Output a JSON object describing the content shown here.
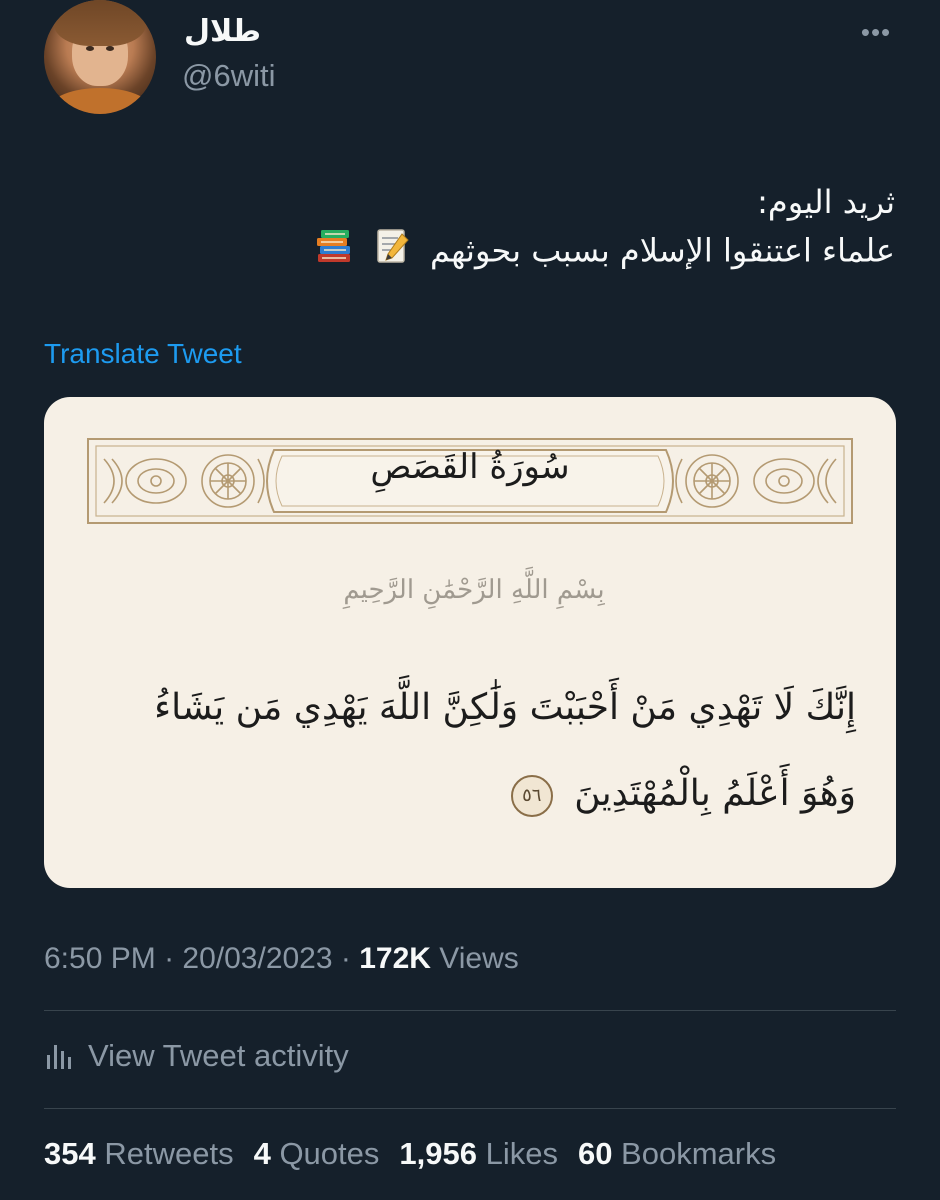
{
  "author": {
    "display_name": "طلال",
    "handle": "@6witi",
    "avatar_icon": "avatar-photo"
  },
  "header": {
    "more_icon": "more-horizontal-icon",
    "more_glyph": "•••"
  },
  "tweet": {
    "line1": "ثريد اليوم:",
    "line2": "علماء اعتنقوا الإسلام بسبب بحوثهم",
    "emojis": [
      "memo-icon",
      "books-icon"
    ],
    "translate_label": "Translate Tweet"
  },
  "media": {
    "surah_name": "سُورَةُ القَصَصِ",
    "basmala": "بِسْمِ اللَّهِ الرَّحْمَٰنِ الرَّحِيمِ",
    "ayah_line1": "إِنَّكَ لَا تَهْدِي مَنْ أَحْبَبْتَ وَلَٰكِنَّ اللَّهَ يَهْدِي مَن يَشَاءُ",
    "ayah_line2": "وَهُوَ أَعْلَمُ بِالْمُهْتَدِينَ",
    "ayah_number": "٥٦"
  },
  "meta": {
    "time": "6:50 PM",
    "sep1": " · ",
    "date": "20/03/2023",
    "sep2": " · ",
    "views_count": "172K",
    "views_label": " Views"
  },
  "activity": {
    "label": "View Tweet activity",
    "icon": "bar-chart-icon"
  },
  "stats": {
    "retweets_count": "354",
    "retweets_label": " Retweets",
    "quotes_count": "4",
    "quotes_label": " Quotes",
    "likes_count": "1,956",
    "likes_label": " Likes",
    "bookmarks_count": "60",
    "bookmarks_label": " Bookmarks"
  },
  "colors": {
    "background": "#15202b",
    "text_primary": "#f7f9f9",
    "text_secondary": "#8b98a5",
    "link": "#1d9bf0",
    "divider": "#38444d",
    "card_background": "#f6f0e6",
    "ornament": "#b49a72"
  }
}
